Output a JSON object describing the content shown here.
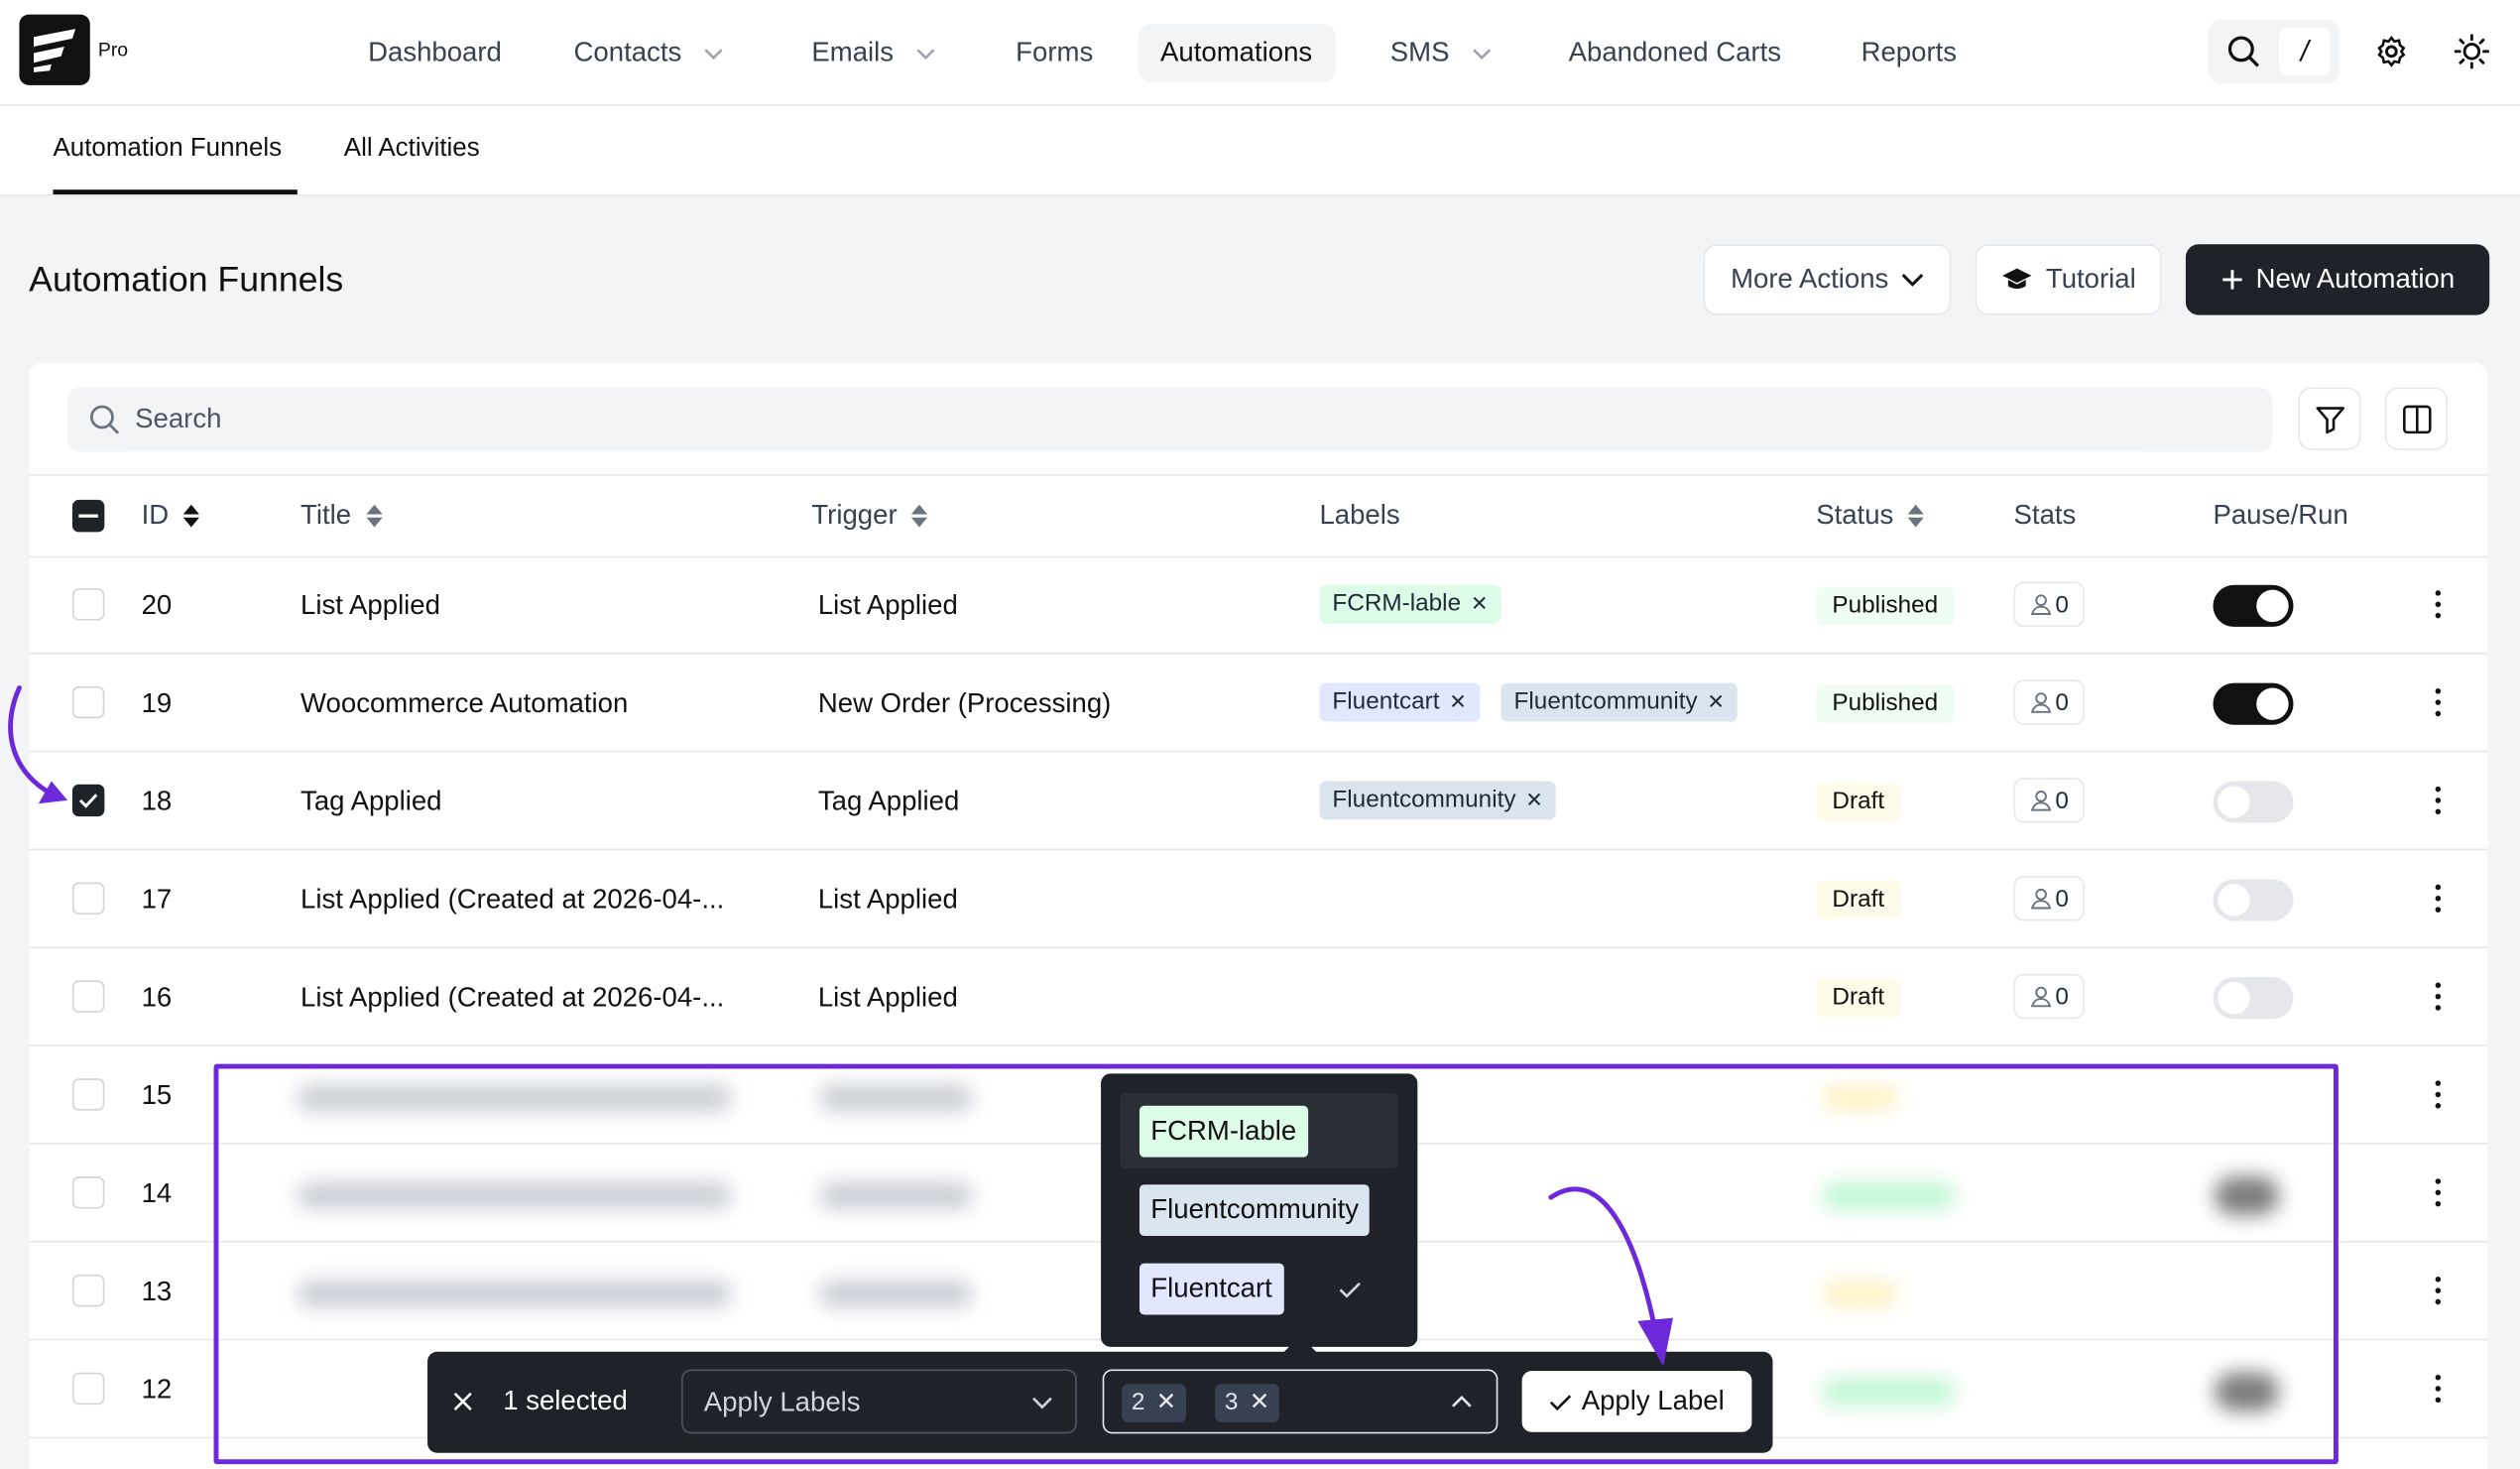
{
  "app": {
    "badge": "Pro"
  },
  "nav": [
    {
      "label": "Dashboard",
      "has_dropdown": false
    },
    {
      "label": "Contacts",
      "has_dropdown": true
    },
    {
      "label": "Emails",
      "has_dropdown": true
    },
    {
      "label": "Forms",
      "has_dropdown": false
    },
    {
      "label": "Automations",
      "has_dropdown": false,
      "active": true
    },
    {
      "label": "SMS",
      "has_dropdown": true
    },
    {
      "label": "Abandoned Carts",
      "has_dropdown": false
    },
    {
      "label": "Reports",
      "has_dropdown": false
    }
  ],
  "search_shortcut": "/",
  "subtabs": [
    {
      "label": "Automation Funnels",
      "active": true
    },
    {
      "label": "All Activities",
      "active": false
    }
  ],
  "page": {
    "title": "Automation Funnels",
    "more_actions": "More Actions",
    "tutorial": "Tutorial",
    "new_automation": "New Automation"
  },
  "search": {
    "placeholder": "Search"
  },
  "columns": {
    "id": "ID",
    "title": "Title",
    "trigger": "Trigger",
    "labels": "Labels",
    "status": "Status",
    "stats": "Stats",
    "pause_run": "Pause/Run"
  },
  "rows": [
    {
      "id": "20",
      "title": "List Applied",
      "trigger": "List Applied",
      "labels": [
        {
          "name": "FCRM-lable",
          "color": "#dcfce7"
        }
      ],
      "status": "Published",
      "stats": "0",
      "running": true,
      "checked": false
    },
    {
      "id": "19",
      "title": "Woocommerce Automation",
      "trigger": "New Order (Processing)",
      "labels": [
        {
          "name": "Fluentcart",
          "color": "#e0e7ff"
        },
        {
          "name": "Fluentcommunity",
          "color": "#dbe5ef"
        }
      ],
      "status": "Published",
      "stats": "0",
      "running": true,
      "checked": false
    },
    {
      "id": "18",
      "title": "Tag Applied",
      "trigger": "Tag Applied",
      "labels": [
        {
          "name": "Fluentcommunity",
          "color": "#dbe5ef"
        }
      ],
      "status": "Draft",
      "stats": "0",
      "running": false,
      "checked": true
    },
    {
      "id": "17",
      "title": "List Applied (Created at 2026-04-...",
      "trigger": "List Applied",
      "labels": [],
      "status": "Draft",
      "stats": "0",
      "running": false,
      "checked": false
    },
    {
      "id": "16",
      "title": "List Applied (Created at 2026-04-...",
      "trigger": "List Applied",
      "labels": [],
      "status": "Draft",
      "stats": "0",
      "running": false,
      "checked": false
    },
    {
      "id": "15",
      "checked": false
    },
    {
      "id": "14",
      "checked": false
    },
    {
      "id": "13",
      "checked": false
    },
    {
      "id": "12",
      "checked": false
    }
  ],
  "dropdown": {
    "options": [
      {
        "label": "FCRM-lable",
        "color": "#dcfce7",
        "selected": false
      },
      {
        "label": "Fluentcommunity",
        "color": "#dbe5ef",
        "selected": false
      },
      {
        "label": "Fluentcart",
        "color": "#e0e7ff",
        "selected": true
      }
    ]
  },
  "bulk": {
    "count_label": "1 selected",
    "action_select": "Apply Labels",
    "chips": [
      "2",
      "3"
    ],
    "apply_button": "Apply Label"
  },
  "colors": {
    "annotation": "#6d28d9",
    "dark": "#1f2329"
  }
}
